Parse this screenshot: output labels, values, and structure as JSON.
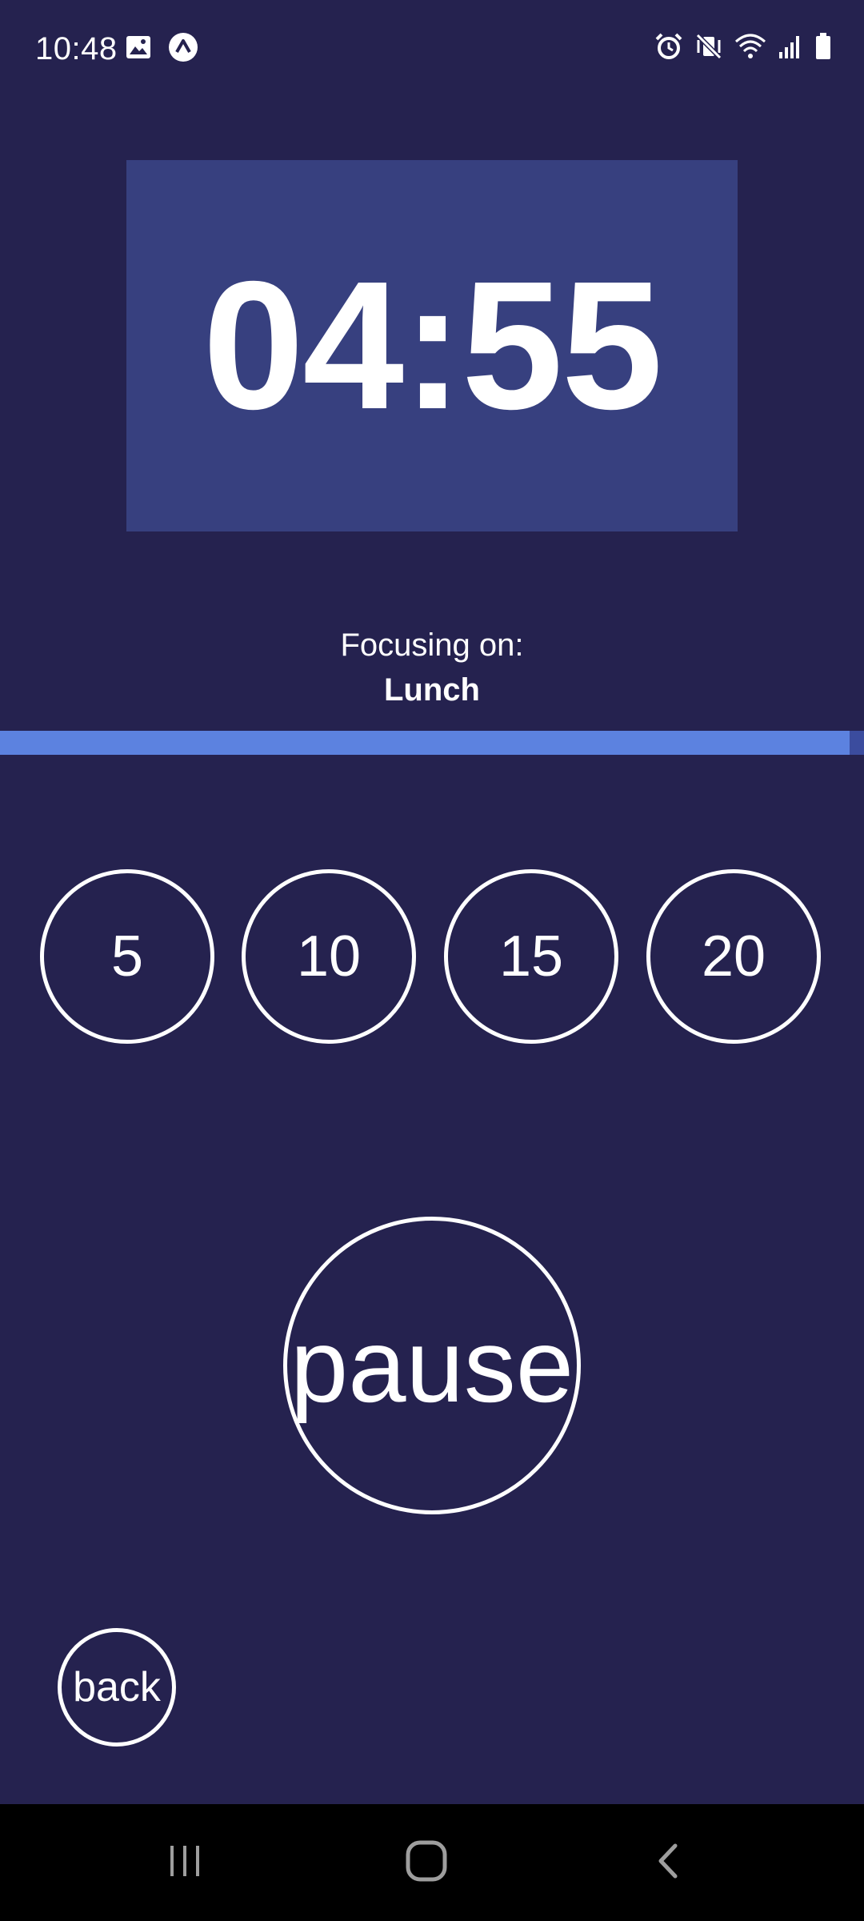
{
  "status_bar": {
    "time": "10:48",
    "left_icons": [
      "gallery-icon",
      "app-notification-icon"
    ],
    "right_icons": [
      "alarm-icon",
      "vibrate-mute-icon",
      "wifi-icon",
      "signal-icon",
      "battery-icon"
    ]
  },
  "timer": {
    "display": "04:55"
  },
  "focus": {
    "label": "Focusing on:",
    "task": "Lunch"
  },
  "progress": {
    "fraction": 0.983
  },
  "presets": [
    "5",
    "10",
    "15",
    "20"
  ],
  "controls": {
    "pause_label": "pause",
    "back_label": "back"
  },
  "nav_bar": {
    "icons": [
      "recents-icon",
      "home-icon",
      "back-arrow-icon"
    ]
  },
  "colors": {
    "background": "#25224f",
    "timer_card": "#37407f",
    "progress_fill": "#5c82e0",
    "progress_track": "#3b4c9e"
  }
}
